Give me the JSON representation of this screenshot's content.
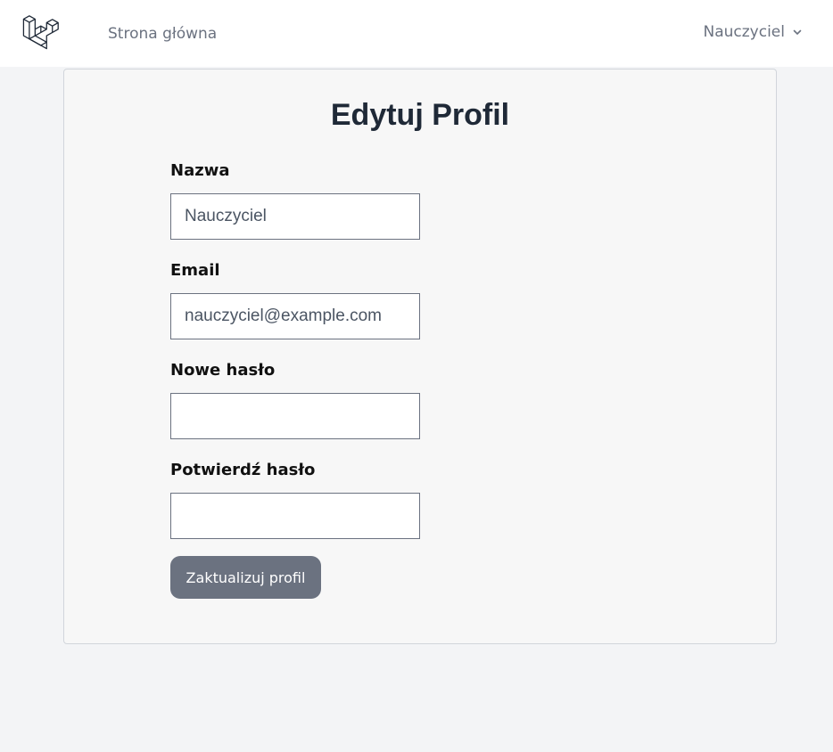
{
  "header": {
    "logo_icon": "laravel-logo-icon",
    "nav_home": "Strona główna",
    "user_name": "Nauczyciel",
    "user_menu_icon": "chevron-down-icon"
  },
  "form": {
    "title": "Edytuj Profil",
    "name_label": "Nazwa",
    "name_value": "Nauczyciel",
    "email_label": "Email",
    "email_value": "nauczyciel@example.com",
    "password_label": "Nowe hasło",
    "password_value": "",
    "confirm_label": "Potwierdź hasło",
    "confirm_value": "",
    "submit_label": "Zaktualizuj profil"
  },
  "colors": {
    "page_background": "#f3f4f6",
    "card_background": "#f7f7f7",
    "button_background": "#6b7280",
    "muted_text": "#6b7280"
  }
}
